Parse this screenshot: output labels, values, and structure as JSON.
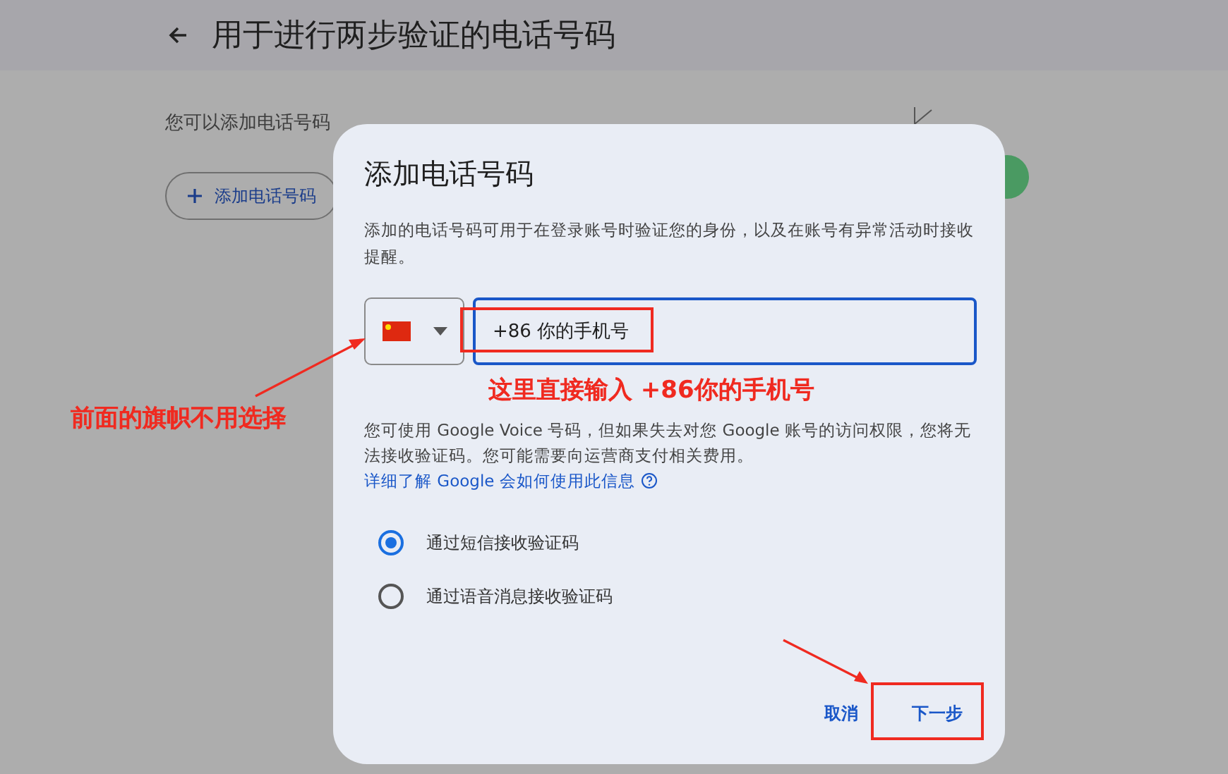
{
  "page": {
    "title": "用于进行两步验证的电话号码",
    "description": "您可以添加电话号码",
    "add_button": "添加电话号码"
  },
  "dialog": {
    "title": "添加电话号码",
    "description": "添加的电话号码可用于在登录账号时验证您的身份，以及在账号有异常活动时接收提醒。",
    "phone_field": {
      "value": "+86 你的手机号",
      "focused": true
    },
    "notice": "您可使用 Google Voice 号码，但如果失去对您 Google 账号的访问权限，您将无法接收验证码。您可能需要向运营商支付相关费用。",
    "link": "详细了解 Google 会如何使用此信息",
    "options": [
      {
        "label": "通过短信接收验证码",
        "selected": true
      },
      {
        "label": "通过语音消息接收验证码",
        "selected": false
      }
    ],
    "buttons": [
      {
        "label": "取消",
        "kind": "text"
      },
      {
        "label": "下一步",
        "kind": "text"
      }
    ]
  },
  "annotations": [
    {
      "text": "这里直接输入 +86你的手机号"
    },
    {
      "text": "前面的旗帜不用选择"
    }
  ]
}
